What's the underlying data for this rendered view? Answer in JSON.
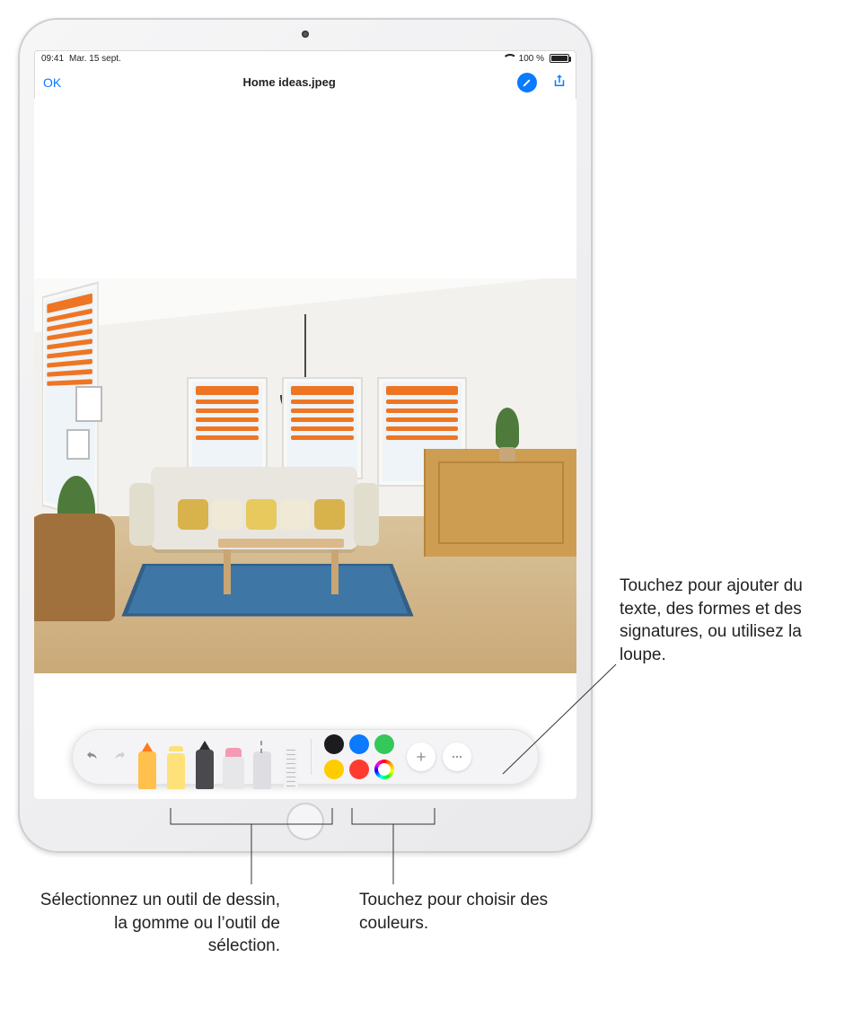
{
  "statusbar": {
    "time": "09:41",
    "date": "Mar. 15 sept.",
    "battery_pct": "100 %"
  },
  "navbar": {
    "ok": "OK",
    "title": "Home ideas.jpeg",
    "markup_icon": "markup-pen-icon",
    "share_icon": "share-icon"
  },
  "colors": {
    "accent": "#0a7aff",
    "markup_stroke": "#ee7523"
  },
  "markup_bar": {
    "undo": "undo-icon",
    "redo": "redo-icon",
    "tools": [
      {
        "name": "felt-pen",
        "selected": true
      },
      {
        "name": "highlighter"
      },
      {
        "name": "pencil"
      },
      {
        "name": "eraser"
      },
      {
        "name": "lasso"
      },
      {
        "name": "ruler"
      }
    ],
    "palette": [
      {
        "name": "black",
        "hex": "#1c1c1e"
      },
      {
        "name": "blue",
        "hex": "#0a7aff"
      },
      {
        "name": "green",
        "hex": "#34c759"
      },
      {
        "name": "yellow",
        "hex": "#ffcc00"
      },
      {
        "name": "red",
        "hex": "#ff3b30"
      },
      {
        "name": "picker",
        "hex": "picker"
      }
    ],
    "add": "plus-icon",
    "more": "more-icon"
  },
  "callouts": {
    "right": "Touchez pour ajouter du texte, des formes et des signatures, ou utilisez la loupe.",
    "bottom_left": "Sélectionnez un outil de dessin, la gomme ou l’outil de sélection.",
    "bottom_center": "Touchez pour choisir des couleurs."
  }
}
